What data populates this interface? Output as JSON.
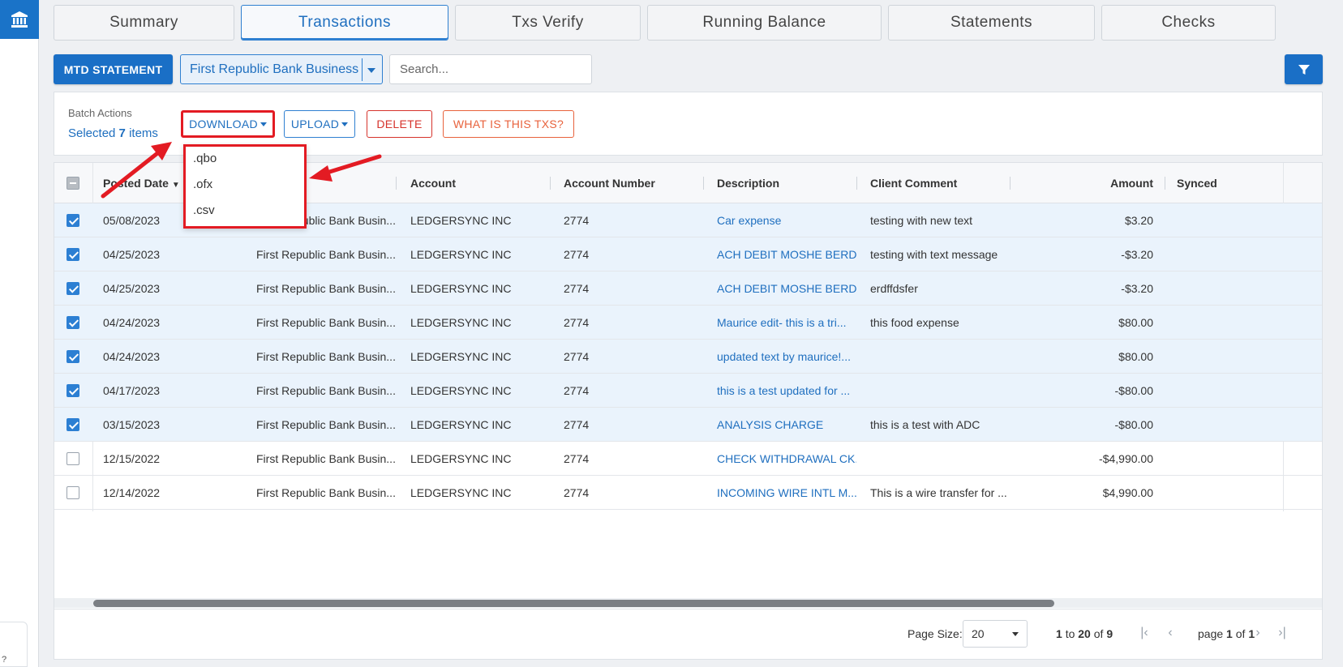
{
  "tabs": [
    "Summary",
    "Transactions",
    "Txs Verify",
    "Running Balance",
    "Statements",
    "Checks"
  ],
  "toolbar": {
    "mtd_label": "MTD STATEMENT",
    "bank_selected": "First Republic Bank Business",
    "search_placeholder": "Search..."
  },
  "batch": {
    "title": "Batch Actions",
    "selected_prefix": "Selected",
    "selected_count": "7",
    "selected_suffix": "items",
    "download": "DOWNLOAD",
    "upload": "UPLOAD",
    "delete": "DELETE",
    "what": "WHAT IS THIS TXS?"
  },
  "download_menu": [
    ".qbo",
    ".ofx",
    ".csv"
  ],
  "columns": {
    "posted_date": "Posted Date",
    "account": "Account",
    "account_number": "Account Number",
    "description": "Description",
    "client_comment": "Client Comment",
    "amount": "Amount",
    "synced": "Synced I"
  },
  "rows": [
    {
      "checked": true,
      "date": "05/08/2023",
      "bank": "First Republic Bank Busin...",
      "account": "LEDGERSYNC INC",
      "number": "2774",
      "description": "Car expense",
      "comment": "testing with new text",
      "amount": "$3.20"
    },
    {
      "checked": true,
      "date": "04/25/2023",
      "bank": "First Republic Bank Busin...",
      "account": "LEDGERSYNC INC",
      "number": "2774",
      "description": "ACH DEBIT MOSHE BERD...",
      "comment": "testing with text message",
      "amount": "-$3.20"
    },
    {
      "checked": true,
      "date": "04/25/2023",
      "bank": "First Republic Bank Busin...",
      "account": "LEDGERSYNC INC",
      "number": "2774",
      "description": "ACH DEBIT MOSHE BERD...",
      "comment": "erdffdsfer",
      "amount": "-$3.20"
    },
    {
      "checked": true,
      "date": "04/24/2023",
      "bank": "First Republic Bank Busin...",
      "account": "LEDGERSYNC INC",
      "number": "2774",
      "description": "Maurice edit- this is a tri...",
      "comment": "this food expense",
      "amount": "$80.00"
    },
    {
      "checked": true,
      "date": "04/24/2023",
      "bank": "First Republic Bank Busin...",
      "account": "LEDGERSYNC INC",
      "number": "2774",
      "description": "updated text by maurice!...",
      "comment": "",
      "amount": "$80.00"
    },
    {
      "checked": true,
      "date": "04/17/2023",
      "bank": "First Republic Bank Busin...",
      "account": "LEDGERSYNC INC",
      "number": "2774",
      "description": "this is a test updated for ...",
      "comment": "",
      "amount": "-$80.00"
    },
    {
      "checked": true,
      "date": "03/15/2023",
      "bank": "First Republic Bank Busin...",
      "account": "LEDGERSYNC INC",
      "number": "2774",
      "description": "ANALYSIS CHARGE",
      "comment": "this is a test with ADC",
      "amount": "-$80.00"
    },
    {
      "checked": false,
      "date": "12/15/2022",
      "bank": "First Republic Bank Busin...",
      "account": "LEDGERSYNC INC",
      "number": "2774",
      "description": "CHECK WITHDRAWAL CK...",
      "comment": "",
      "amount": "-$4,990.00"
    },
    {
      "checked": false,
      "date": "12/14/2022",
      "bank": "First Republic Bank Busin...",
      "account": "LEDGERSYNC INC",
      "number": "2774",
      "description": "INCOMING WIRE INTL M...",
      "comment": "This is a wire transfer for ...",
      "amount": "$4,990.00"
    }
  ],
  "pager": {
    "page_size_label": "Page Size:",
    "page_size": "20",
    "range_start": "1",
    "range_to": "to",
    "range_end": "20",
    "range_of": "of",
    "total": "9",
    "page_word": "page",
    "page_current": "1",
    "page_of": "of",
    "page_total": "1"
  },
  "help_text": "?",
  "colors": {
    "primary": "#1a6fc6",
    "annotation_red": "#e31b23",
    "selected_row": "#eaf3fc",
    "link": "#1f6fbf"
  },
  "icons": [
    "bank-icon",
    "filter-icon",
    "first-page-icon",
    "prev-page-icon",
    "next-page-icon",
    "last-page-icon",
    "sort-desc-icon"
  ]
}
